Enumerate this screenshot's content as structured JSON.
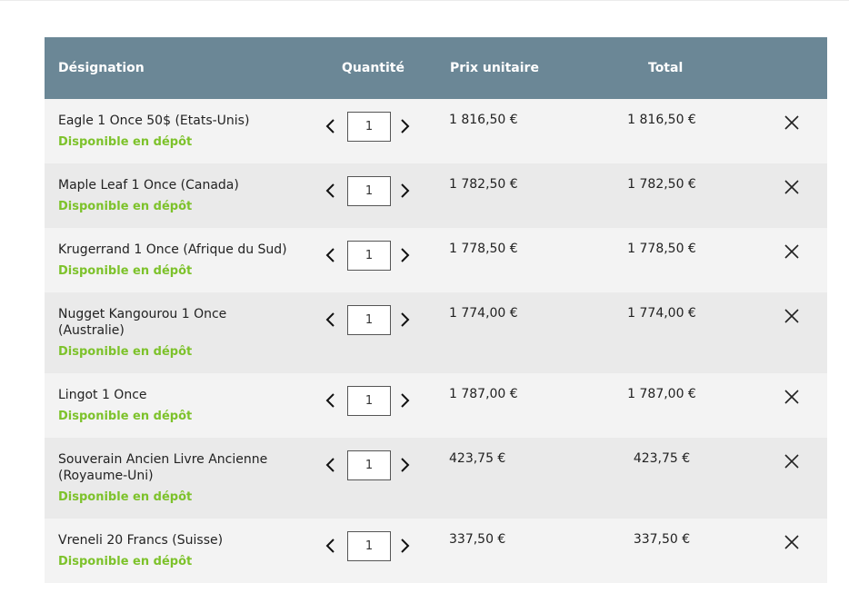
{
  "header": {
    "designation": "Désignation",
    "quantite": "Quantité",
    "prix_unitaire": "Prix unitaire",
    "total": "Total"
  },
  "items": [
    {
      "name": "Eagle 1 Once 50$ (Etats-Unis)",
      "status": "Disponible en dépôt",
      "quantity": "1",
      "unit_price": "1 816,50 €",
      "total": "1 816,50 €"
    },
    {
      "name": "Maple Leaf 1 Once (Canada)",
      "status": "Disponible en dépôt",
      "quantity": "1",
      "unit_price": "1 782,50 €",
      "total": "1 782,50 €"
    },
    {
      "name": "Krugerrand 1 Once (Afrique du Sud)",
      "status": "Disponible en dépôt",
      "quantity": "1",
      "unit_price": "1 778,50 €",
      "total": "1 778,50 €"
    },
    {
      "name": "Nugget Kangourou 1 Once (Australie)",
      "status": "Disponible en dépôt",
      "quantity": "1",
      "unit_price": "1 774,00 €",
      "total": "1 774,00 €"
    },
    {
      "name": "Lingot 1 Once",
      "status": "Disponible en dépôt",
      "quantity": "1",
      "unit_price": "1 787,00 €",
      "total": "1 787,00 €"
    },
    {
      "name": "Souverain Ancien Livre Ancienne (Royaume-Uni)",
      "status": "Disponible en dépôt",
      "quantity": "1",
      "unit_price": "423,75 €",
      "total": "423,75 €"
    },
    {
      "name": "Vreneli 20 Francs (Suisse)",
      "status": "Disponible en dépôt",
      "quantity": "1",
      "unit_price": "337,50 €",
      "total": "337,50 €"
    }
  ],
  "icons": {
    "decrease": "chevron-left-icon",
    "increase": "chevron-right-icon",
    "remove": "close-icon"
  },
  "colors": {
    "header_bg": "#6b8796",
    "status_green": "#7dc22b",
    "row_light": "#f3f3f3",
    "row_dark": "#eaeaea"
  }
}
